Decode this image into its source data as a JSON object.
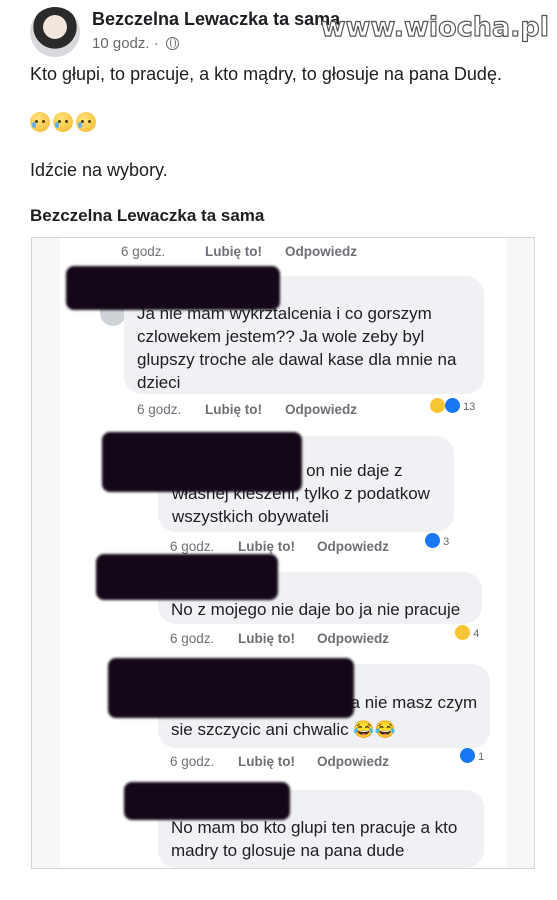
{
  "post": {
    "author": "Bezczelna Lewaczka ta sama",
    "time": "10 godz. ·",
    "text": "Kto głupi, to pracuje, a kto mądry, to głosuje na pana Dudę.",
    "call_to_action": "Idźcie na wybory.",
    "shared_title": "Bezczelna Lewaczka ta sama"
  },
  "watermark": "www.wiocha.pl",
  "comments": [
    {
      "text_lines": [
        "Ja nie mam wykrztalcenia i co gorszym",
        "czlowekem jestem?? Ja wole zeby byl",
        "glupszy troche ale dawal kase dla mnie na",
        "dzieci"
      ],
      "time": "6 godz.",
      "like": "Lubię to!",
      "reply": "Odpowiedz",
      "reactions": "13"
    },
    {
      "text_lines": [
        "ka ale on nie daje z",
        "własnej kieszeni, tylko z podatkow",
        "wszystkich obywateli"
      ],
      "time": "6 godz.",
      "like": "Lubię to!",
      "reply": "Odpowiedz",
      "reactions": "3"
    },
    {
      "text_lines": [
        "No z mojego nie daje bo ja nie pracuje"
      ],
      "time": "6 godz.",
      "like": "Lubię to!",
      "reply": "Odpowiedz",
      "reactions": "4"
    },
    {
      "text_lines": [
        "a haha nie masz czym",
        "sie szczycic ani chwalic 😂😂"
      ],
      "time": "6 godz.",
      "like": "Lubię to!",
      "reply": "Odpowiedz",
      "reactions": "1"
    },
    {
      "text_lines": [
        "No mam bo kto glupi ten pracuje a kto",
        "madry to glosuje na pana dude"
      ],
      "time": "",
      "like": "",
      "reply": "",
      "reactions": ""
    }
  ],
  "top_actions": {
    "time": "6 godz.",
    "like": "Lubię to!",
    "reply": "Odpowiedz"
  },
  "colors": {
    "text": "#1c1e21",
    "secondary": "#65676b",
    "like_blue": "#1877f2",
    "redaction": "#140818"
  }
}
